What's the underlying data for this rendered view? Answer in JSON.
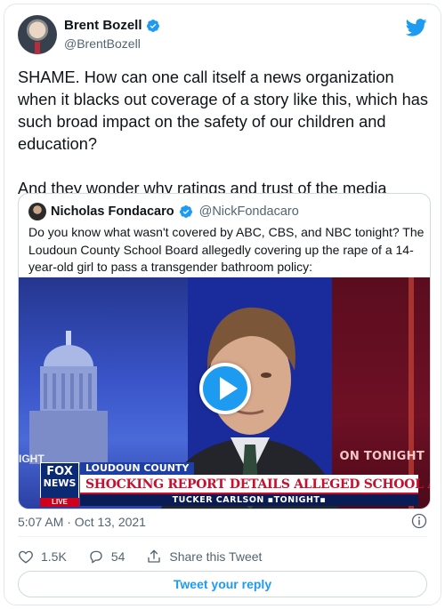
{
  "author": {
    "display_name": "Brent Bozell",
    "handle": "@BrentBozell"
  },
  "tweet": {
    "text": "SHAME. How can one call itself a news organization when it blacks out coverage of a story like this, which has such broad impact on the safety of our children and education?\n\nAnd they wonder why ratings and trust of the media continue to tank.",
    "timestamp": "5:07 AM · Oct 13, 2021"
  },
  "quoted_tweet": {
    "display_name": "Nicholas Fondacaro",
    "handle": "@NickFondacaro",
    "text": "Do you know what wasn't covered by ABC, CBS, and NBC tonight? The Loudoun County School Board allegedly covering up the rape of a 14-year-old girl to pass a transgender bathroom policy:"
  },
  "video": {
    "channel_logo_line1": "FOX",
    "channel_logo_line2": "NEWS",
    "live_label": "LIVE",
    "location_tag": "LOUDOUN COUNTY",
    "headline": "SHOCKING REPORT DETAILS ALLEGED SCHOOL ATTACK",
    "show_name": "TUCKER CARLSON ▪TONIGHT▪",
    "background_text_right": "ON TONIGHT",
    "background_text_left": "IGHT"
  },
  "actions": {
    "like_count": "1.5K",
    "reply_count": "54",
    "share_label": "Share this Tweet"
  },
  "reply_button_label": "Tweet your reply",
  "colors": {
    "brand_blue": "#1d9bf0",
    "text_primary": "#0f1419",
    "text_secondary": "#536471",
    "border": "#cfd9de"
  },
  "icons": [
    "twitter-bird-icon",
    "verified-badge-icon",
    "play-icon",
    "info-icon",
    "heart-icon",
    "reply-icon",
    "share-icon"
  ]
}
